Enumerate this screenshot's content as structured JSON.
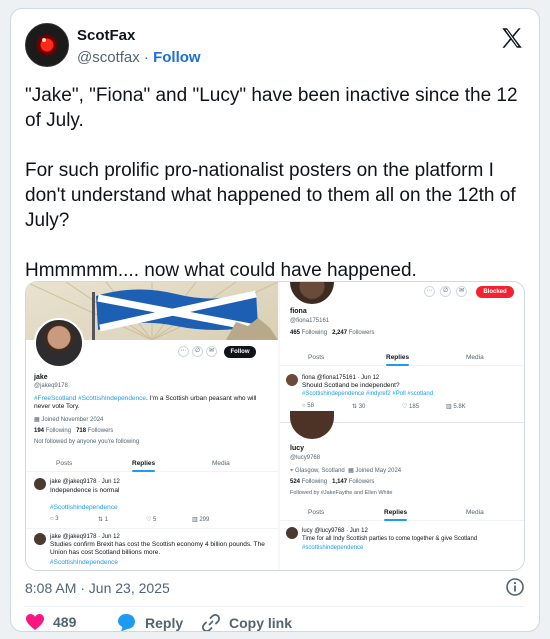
{
  "author": {
    "name": "ScotFax",
    "handle": "@scotfax",
    "separator": "·",
    "follow_label": "Follow"
  },
  "tweet": {
    "text": "\"Jake\", \"Fiona\" and \"Lucy\" have been inactive since the 12 of July.\n\nFor such prolific pro-nationalist posters on the platform I don't understand what happened to them all on the 12th of July?\n\nHmmmmm.... now what could have happened."
  },
  "embed": {
    "jake": {
      "name": "jake",
      "handle": "@jakeq9178",
      "bio_tags": "#FreeScotland #ScottishIndependence",
      "bio_text": ". I'm a Scottish urban peasant who will never vote Tory.",
      "joined": "Joined November 2024",
      "following_count": "194",
      "following_label": "Following",
      "followers_count": "718",
      "followers_label": "Followers",
      "not_followed": "Not followed by anyone you're following",
      "follow_button": "Follow",
      "tabs": [
        "Posts",
        "Replies",
        "Media"
      ],
      "post1": {
        "meta": "jake @jakeq9178 · Jun 12",
        "text": "Independence is normal",
        "tag": "#Scottishindependence",
        "metrics": [
          "3",
          "1",
          "5",
          "299"
        ]
      },
      "post2": {
        "meta": "jake @jakeq9178 · Jun 12",
        "text": "Studies confirm Brexit has cost the Scottish economy 4 billion pounds. The Union has cost Scotland billions more.",
        "tag": "#ScottishIndependence"
      }
    },
    "fiona": {
      "name": "fiona",
      "handle": "@fiona175161",
      "following_count": "465",
      "following_label": "Following",
      "followers_count": "2,247",
      "followers_label": "Followers",
      "blocked_label": "Blocked",
      "tabs": [
        "Posts",
        "Replies",
        "Media"
      ],
      "post": {
        "meta": "fiona @fiona175161 · Jun 12",
        "text": "Should Scotland be independent?",
        "tags": "#Scottishindependence #indyref2 #Poll #scotland",
        "metrics": [
          "58",
          "30",
          "185",
          "5.8K"
        ]
      }
    },
    "lucy": {
      "name": "lucy",
      "handle": "@lucy9768",
      "location": "Glasgow, Scotland",
      "joined": "Joined May 2024",
      "following_count": "524",
      "following_label": "Following",
      "followers_count": "1,147",
      "followers_label": "Followers",
      "followed_by": "Followed by #JakeFaythe and Ellen White",
      "tabs": [
        "Posts",
        "Replies",
        "Media"
      ],
      "post": {
        "meta": "lucy @lucy9768 · Jun 12",
        "text": "Time for all Indy Scottish parties to come together & give Scotland",
        "tag": "#scottishindependence"
      }
    }
  },
  "footer": {
    "timestamp": "8:08 AM · Jun 23, 2025",
    "like_count": "489",
    "reply_label": "Reply",
    "copy_link_label": "Copy link"
  },
  "colors": {
    "like": "#f91880",
    "reply": "#1d9bf0",
    "link": "#1d6fd8",
    "muted": "#536471"
  }
}
